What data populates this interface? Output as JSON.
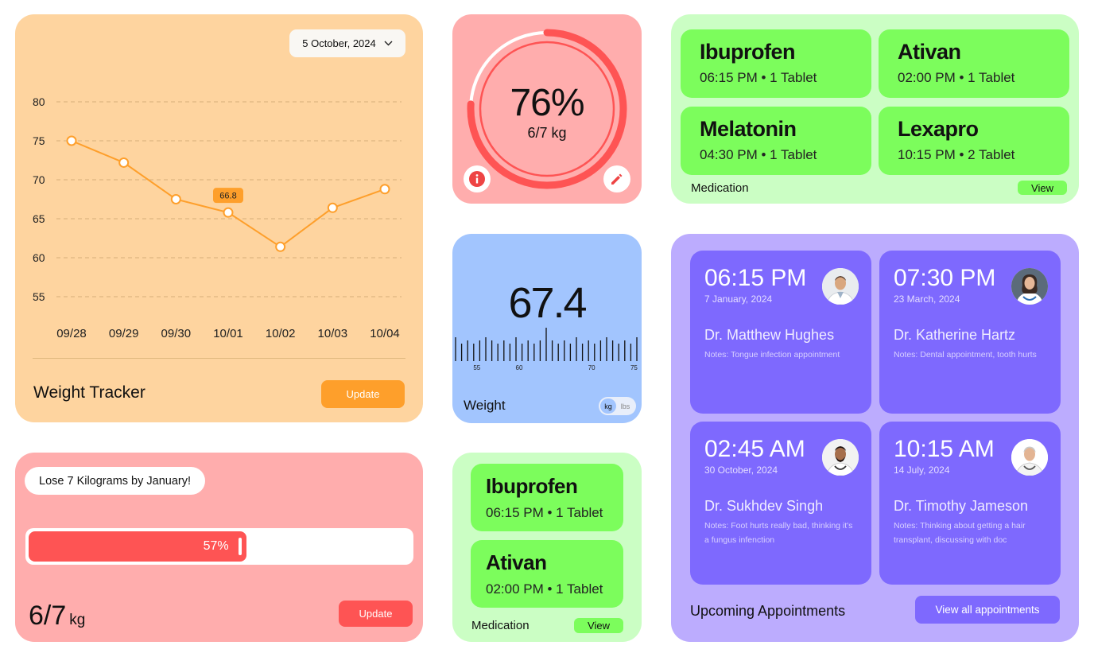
{
  "weight_tracker": {
    "date_selector": "5 October, 2024",
    "title": "Weight Tracker",
    "update_label": "Update",
    "tooltip_value": "66.8",
    "colors": {
      "card": "#fed49f",
      "line": "#fe9f2b",
      "button": "#fe9f2b"
    },
    "chart_data": {
      "type": "line",
      "categories": [
        "09/28",
        "09/29",
        "09/30",
        "10/01",
        "10/02",
        "10/03",
        "10/04"
      ],
      "values": [
        75,
        72.2,
        67.5,
        65.8,
        61.4,
        66.4,
        68.8
      ],
      "highlight_index": 3,
      "yticks": [
        80,
        75,
        70,
        65,
        60,
        55
      ],
      "ylim": [
        55,
        80
      ],
      "grid": "dashed horizontal"
    }
  },
  "goal": {
    "label": "Lose 7 Kilograms by January!",
    "progress_label": "57%",
    "progress_fraction": 0.57,
    "current": "6/7",
    "unit": "kg",
    "update_label": "Update"
  },
  "progress_ring": {
    "percent_label": "76%",
    "percent_fraction": 0.76,
    "subtitle": "6/7 kg",
    "info_icon": "info-icon",
    "edit_icon": "pencil-icon"
  },
  "weight": {
    "value": "67.4",
    "label": "Weight",
    "ruler_labels": [
      "55",
      "60",
      "70",
      "75"
    ],
    "unit_selected": "kg",
    "unit_other": "lbs"
  },
  "medication_small": {
    "items": [
      {
        "name": "Ibuprofen",
        "info": "06:15 PM • 1 Tablet"
      },
      {
        "name": "Ativan",
        "info": "02:00 PM • 1 Tablet"
      }
    ],
    "title": "Medication",
    "view_label": "View"
  },
  "medication_large": {
    "items": [
      {
        "name": "Ibuprofen",
        "info": "06:15 PM • 1 Tablet"
      },
      {
        "name": "Ativan",
        "info": "02:00 PM • 1 Tablet"
      },
      {
        "name": "Melatonin",
        "info": "04:30 PM • 1 Tablet"
      },
      {
        "name": "Lexapro",
        "info": "10:15 PM • 2 Tablet"
      }
    ],
    "title": "Medication",
    "view_label": "View"
  },
  "appointments": {
    "title": "Upcoming Appointments",
    "view_all_label": "View all appointments",
    "items": [
      {
        "time": "06:15 PM",
        "date": "7 January, 2024",
        "doctor": "Dr. Matthew Hughes",
        "notes": "Notes: Tongue infection appointment"
      },
      {
        "time": "07:30 PM",
        "date": "23 March, 2024",
        "doctor": "Dr. Katherine Hartz",
        "notes": "Notes: Dental appointment, tooth hurts"
      },
      {
        "time": "02:45 AM",
        "date": "30 October, 2024",
        "doctor": "Dr. Sukhdev Singh",
        "notes": "Notes: Foot hurts really bad, thinking it's a fungus infenction"
      },
      {
        "time": "10:15 AM",
        "date": "14 July, 2024",
        "doctor": "Dr. Timothy Jameson",
        "notes": "Notes: Thinking about getting a hair transplant, discussing with doc"
      }
    ]
  }
}
